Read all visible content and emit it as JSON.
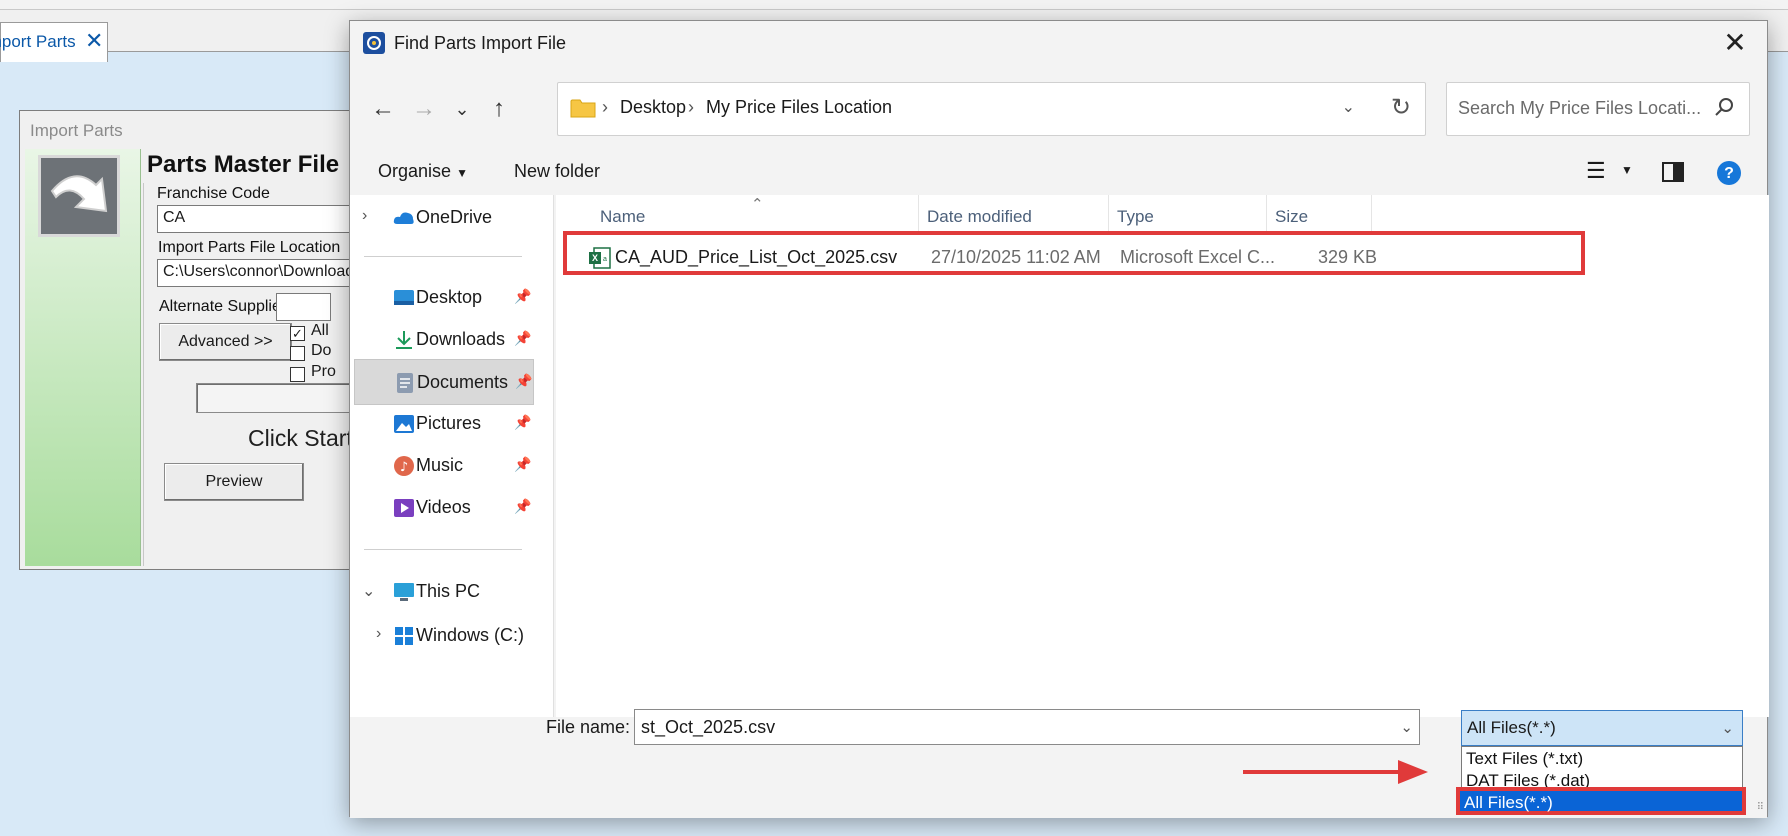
{
  "app": {
    "tab_label": "Import Parts",
    "import_window": {
      "title": "Import Parts",
      "heading": "Parts Master File",
      "franchise_code_label": "Franchise Code",
      "franchise_code_value": "CA",
      "file_location_label": "Import Parts File Location",
      "file_location_value": "C:\\Users\\connor\\Downloads",
      "alternate_supplier_label": "Alternate Supplier",
      "advanced_button": "Advanced >>",
      "checkbox_labels": [
        "All",
        "Do",
        "Pro"
      ],
      "status_text": "Click Start",
      "preview_button": "Preview"
    }
  },
  "dialog": {
    "title": "Find Parts Import File",
    "breadcrumbs": [
      "Desktop",
      "My Price Files Location"
    ],
    "search_placeholder": "Search My Price Files Locati...",
    "toolbar": {
      "organise": "Organise",
      "new_folder": "New folder"
    },
    "nav_pane": [
      {
        "label": "OneDrive",
        "icon": "cloud-icon",
        "expandable": true
      },
      {
        "label": "Desktop",
        "icon": "desktop-icon",
        "pinned": true
      },
      {
        "label": "Downloads",
        "icon": "download-icon",
        "pinned": true
      },
      {
        "label": "Documents",
        "icon": "document-icon",
        "pinned": true,
        "selected": true
      },
      {
        "label": "Pictures",
        "icon": "picture-icon",
        "pinned": true
      },
      {
        "label": "Music",
        "icon": "music-icon",
        "pinned": true
      },
      {
        "label": "Videos",
        "icon": "video-icon",
        "pinned": true
      },
      {
        "label": "This PC",
        "icon": "computer-icon",
        "expanded": true
      },
      {
        "label": "Windows (C:)",
        "icon": "windows-icon"
      }
    ],
    "columns": {
      "name": "Name",
      "date": "Date modified",
      "type": "Type",
      "size": "Size"
    },
    "files": [
      {
        "name": "CA_AUD_Price_List_Oct_2025.csv",
        "date": "27/10/2025 11:02 AM",
        "type": "Microsoft Excel C...",
        "size": "329 KB",
        "icon": "excel-csv-icon"
      }
    ],
    "file_name_label": "File name:",
    "file_name_value": "st_Oct_2025.csv",
    "file_type": {
      "selected": "All Files(*.*)",
      "options": [
        "Text Files (*.txt)",
        "DAT Files (*.dat)",
        "All Files(*.*)"
      ]
    },
    "colors": {
      "highlight_red": "#e03a3a",
      "selection_blue": "#0a64d6",
      "link_text": "#0b58a8"
    }
  }
}
